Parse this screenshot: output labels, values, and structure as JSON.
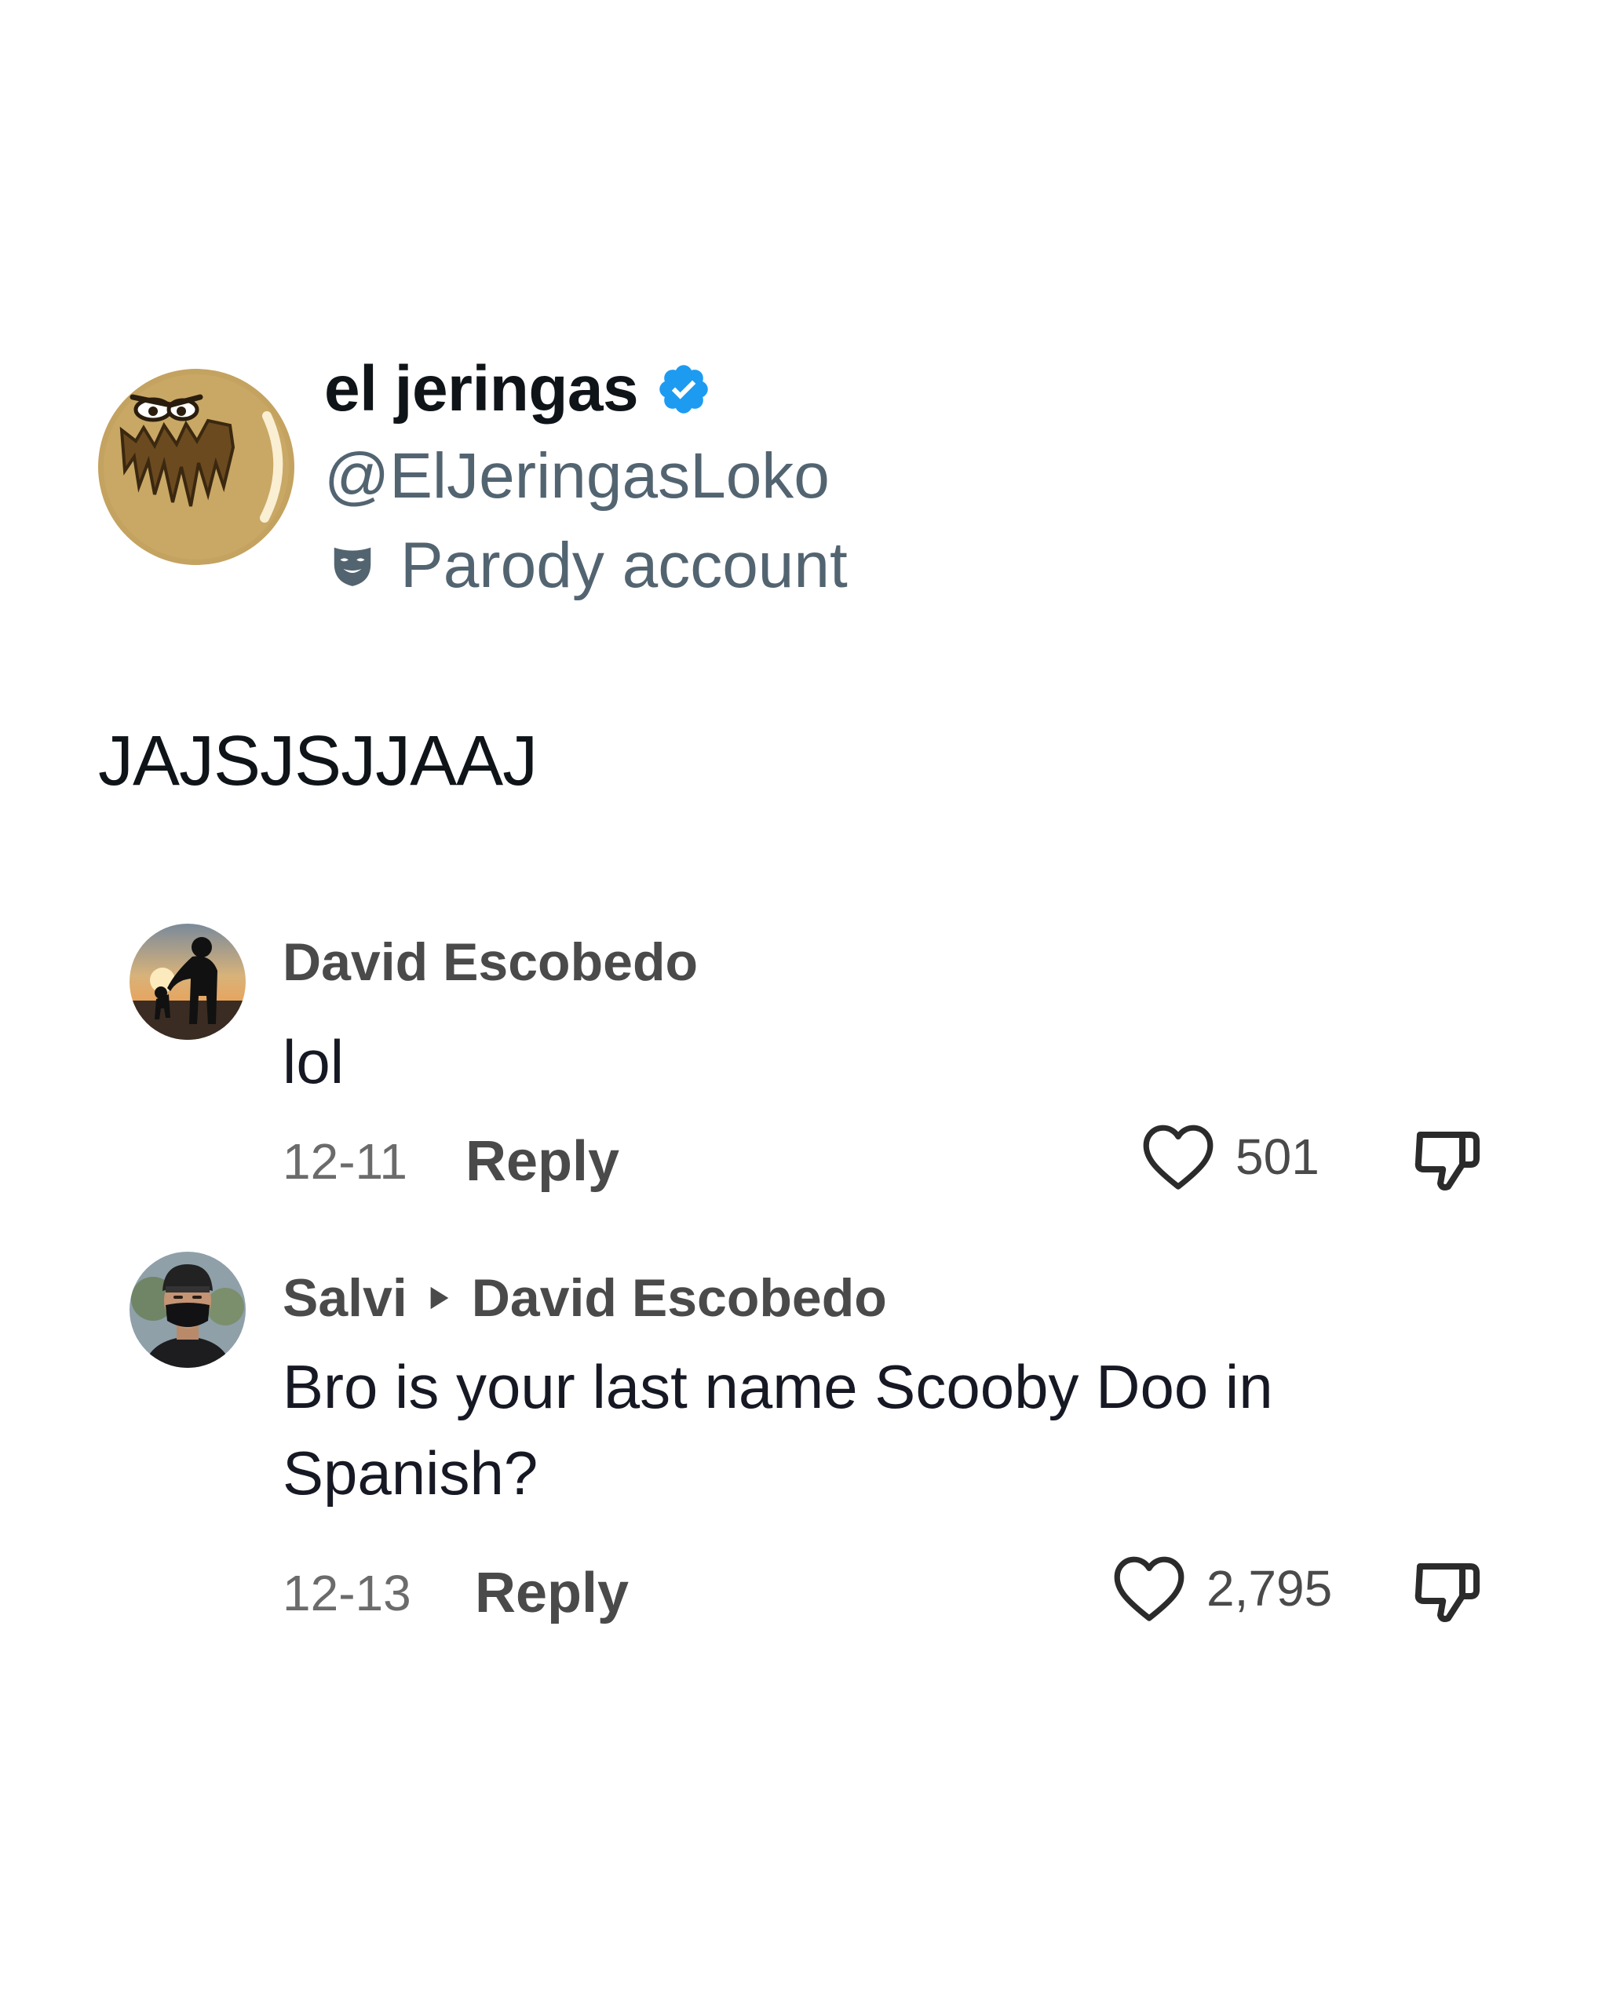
{
  "tweet": {
    "display_name": "el jeringas",
    "handle": "@ElJeringasLoko",
    "parody_label": "Parody account",
    "text": "JAJSJSJJAAJ",
    "verified_icon": "verified-badge-icon",
    "parody_icon": "parody-mask-icon",
    "colors": {
      "verified": "#1d9bf0",
      "secondary_text": "#536471"
    }
  },
  "comments": [
    {
      "author": "David Escobedo",
      "text": "lol",
      "date": "12-11",
      "reply_label": "Reply",
      "likes": "501"
    },
    {
      "author": "Salvi",
      "reply_to": "David Escobedo",
      "text": "Bro is your last name Scooby Doo in Spanish?",
      "date": "12-13",
      "reply_label": "Reply",
      "likes": "2,795"
    }
  ]
}
